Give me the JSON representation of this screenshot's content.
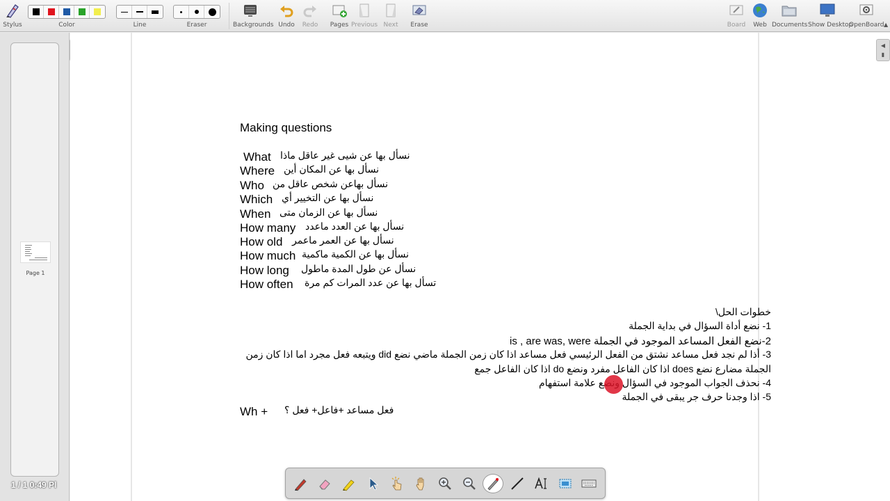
{
  "toolbar": {
    "stylus": "Stylus",
    "color": "Color",
    "line": "Line",
    "eraser": "Eraser",
    "backgrounds": "Backgrounds",
    "undo": "Undo",
    "redo": "Redo",
    "pages": "Pages",
    "previous": "Previous",
    "next": "Next",
    "erase": "Erase",
    "board": "Board",
    "web": "Web",
    "documents": "Documents",
    "show_desktop": "Show Desktop",
    "openboard": "OpenBoard",
    "colors": [
      "#000000",
      "#e0141e",
      "#1f5aa6",
      "#29a329",
      "#f2ee4d"
    ]
  },
  "pages_panel": {
    "thumb_label": "Page 1",
    "counter": "1 / 1 0:49 Pl"
  },
  "board": {
    "title": "Making questions",
    "questions": [
      {
        "en": "What",
        "ar": "نسأل بها عن شيى غير عاقل  ماذا"
      },
      {
        "en": "Where",
        "ar": "نسأل بها عن المكان  أين"
      },
      {
        "en": "Who",
        "ar": "نسأل بهاعن شخص عاقل  من"
      },
      {
        "en": "Which",
        "ar": "نسأل بها عن التخيير  أي"
      },
      {
        "en": "When",
        "ar": "نسأل بها عن الزمان  متى"
      },
      {
        "en": "How many",
        "ar": "نسأل بها عن العدد  ماعدد"
      },
      {
        "en": "How old",
        "ar": "نسأل بها عن العمر   ماعمر"
      },
      {
        "en": "How much",
        "ar": "نسأل بها عن الكمية  ماكمية"
      },
      {
        "en": "How long",
        "ar": "نسأل عن طول المدة   ماطول"
      },
      {
        "en": "How often",
        "ar": "تسأل بها عن عدد المرات   كم مرة"
      }
    ],
    "steps_heading": "خطوات الحل\\",
    "steps": [
      "1- نضع أداة السؤال في بداية الجملة",
      "2-نضع الفعل المساعد الموجود في الجملة  is , are was, were",
      "3- أذا لم نجد فعل مساعد نشتق من الفعل الرئيسي فعل مساعد اذا كان زمن الجملة ماضي نضع  did  ويتبعه فعل مجرد اما اذا كان زمن",
      "الجملة  مضارع نضع  does  اذا كان الفاعل مفرد ونضع  do  اذا كان الفاعل جمع",
      "4- نحذف الجواب الموجود في السؤال ونضع علامة استفهام",
      "5- اذا وجدنا حرف جر يبقى في الجملة"
    ],
    "formula_en": "Wh +",
    "formula_ar": "فعل مساعد  +فاعل+  فعل ؟"
  },
  "palette": {
    "tools": [
      "pen-icon",
      "eraser-icon",
      "marker-icon",
      "selector-icon",
      "interactor-icon",
      "hand-icon",
      "zoom-in-icon",
      "zoom-out-icon",
      "laser-pointer-icon",
      "line-icon",
      "text-icon",
      "capture-icon",
      "keyboard-icon"
    ],
    "active": "laser-pointer-icon"
  }
}
